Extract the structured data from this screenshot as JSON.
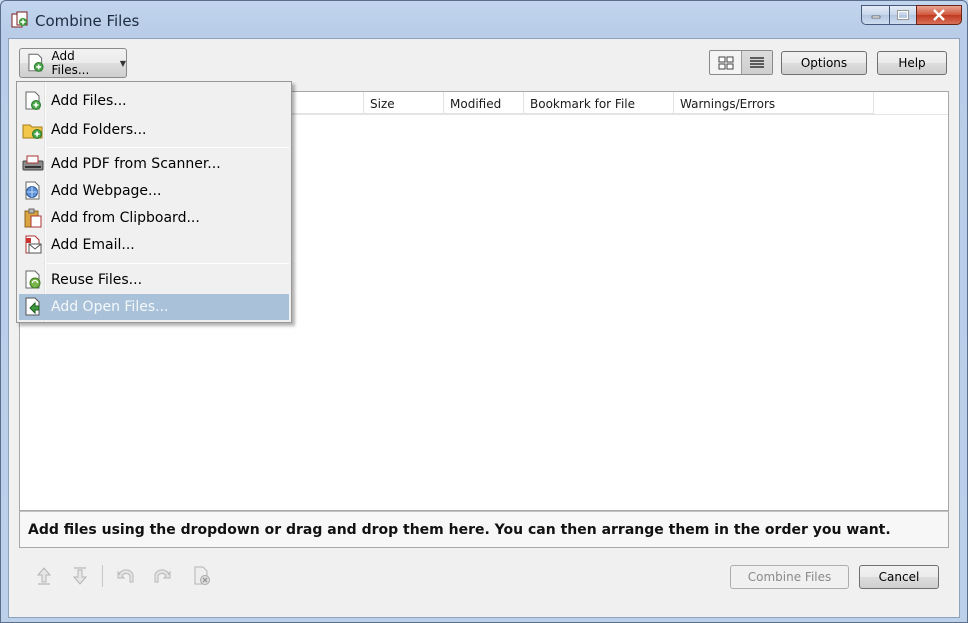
{
  "window": {
    "title": "Combine Files"
  },
  "toolbar": {
    "add_files_label": "Add Files...",
    "options_label": "Options",
    "help_label": "Help"
  },
  "columns": [
    "Size",
    "Modified",
    "Bookmark for File",
    "Warnings/Errors"
  ],
  "hint": "Add files using the dropdown or drag and drop them here. You can then arrange them in the order you want.",
  "footer": {
    "combine_label": "Combine Files",
    "cancel_label": "Cancel"
  },
  "menu": {
    "items": [
      {
        "label": "Add Files...",
        "icon": "add-file-icon"
      },
      {
        "label": "Add Folders...",
        "icon": "add-folder-icon"
      },
      {
        "label": "Add PDF from Scanner...",
        "icon": "scanner-icon"
      },
      {
        "label": "Add Webpage...",
        "icon": "webpage-icon"
      },
      {
        "label": "Add from Clipboard...",
        "icon": "clipboard-icon"
      },
      {
        "label": "Add Email...",
        "icon": "email-icon"
      },
      {
        "label": "Reuse Files...",
        "icon": "reuse-files-icon"
      },
      {
        "label": "Add Open Files...",
        "icon": "open-files-icon",
        "selected": true
      }
    ]
  },
  "colors": {
    "selection": "#a9c2d9",
    "titlebar": "#c2d5ee",
    "close_button": "#c0391f"
  }
}
